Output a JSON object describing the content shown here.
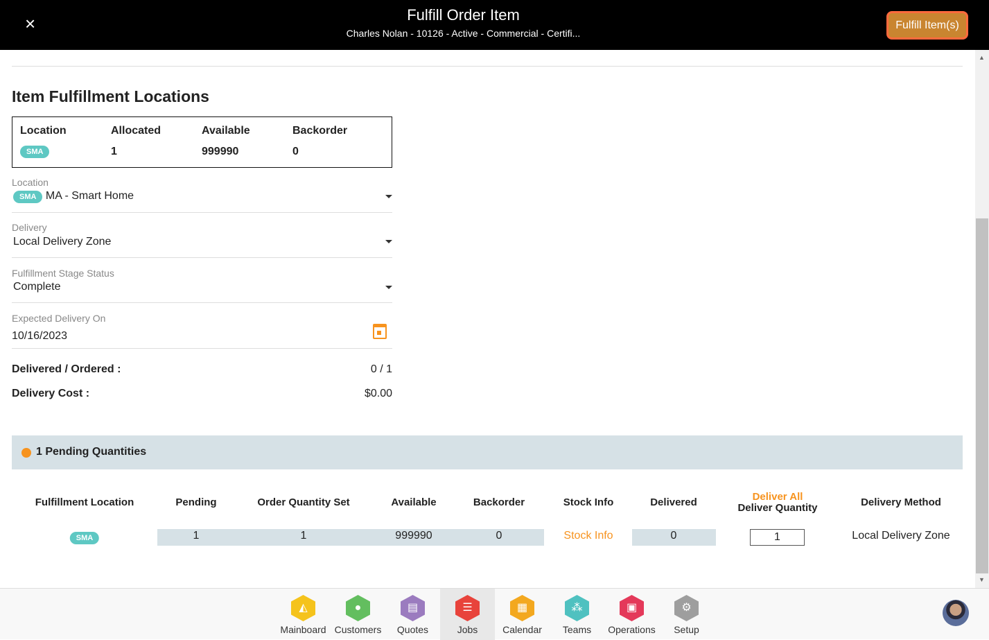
{
  "header": {
    "title": "Fulfill Order Item",
    "subtitle": "Charles Nolan - 10126 - Active - Commercial - Certifi...",
    "close_icon": "×",
    "fulfill_button": "Fulfill Item(s)",
    "accent": "#c98530"
  },
  "section_title": "Item Fulfillment Locations",
  "summary": {
    "headers": [
      "Location",
      "Allocated",
      "Available",
      "Backorder"
    ],
    "badge": "SMA",
    "allocated": "1",
    "available": "999990",
    "backorder": "0"
  },
  "fields": {
    "location": {
      "label": "Location",
      "badge": "SMA",
      "value": "MA - Smart Home"
    },
    "delivery": {
      "label": "Delivery",
      "value": "Local Delivery Zone"
    },
    "stage": {
      "label": "Fulfillment Stage Status",
      "value": "Complete"
    },
    "expected": {
      "label": "Expected Delivery On",
      "value": "10/16/2023"
    }
  },
  "delivered_ordered": {
    "label": "Delivered / Ordered :",
    "value": "0 / 1"
  },
  "delivery_cost": {
    "label": "Delivery Cost :",
    "value": "$0.00"
  },
  "pending": {
    "label": "1 Pending Quantities"
  },
  "table": {
    "headers": [
      "Fulfillment Location",
      "Pending",
      "Order Quantity Set",
      "Available",
      "Backorder",
      "Stock Info",
      "Delivered",
      "Deliver All",
      "Deliver Quantity",
      "Delivery Method"
    ],
    "row": {
      "badge": "SMA",
      "pending": "1",
      "order_qty_set": "1",
      "available": "999990",
      "backorder": "0",
      "stock_info": "Stock Info",
      "delivered": "0",
      "deliver_qty": "1",
      "method": "Local Delivery Zone"
    }
  },
  "nav": [
    {
      "label": "Mainboard",
      "color": "#f5c31c"
    },
    {
      "label": "Customers",
      "color": "#63be5f"
    },
    {
      "label": "Quotes",
      "color": "#9b7bbf"
    },
    {
      "label": "Jobs",
      "color": "#e8433b",
      "active": true
    },
    {
      "label": "Calendar",
      "color": "#f3a81f"
    },
    {
      "label": "Teams",
      "color": "#4fc1c0"
    },
    {
      "label": "Operations",
      "color": "#e4395a"
    },
    {
      "label": "Setup",
      "color": "#9e9e9e"
    }
  ]
}
